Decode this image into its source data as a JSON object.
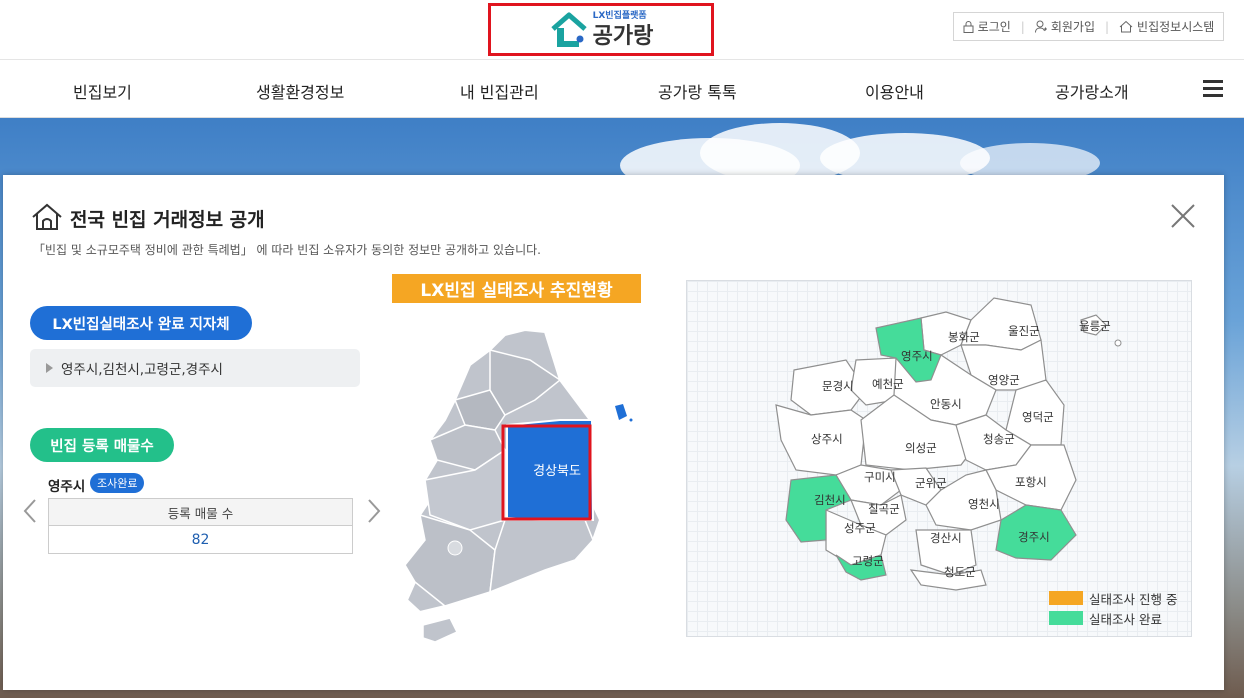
{
  "header": {
    "logo_sub": "LX빈집플랫폼",
    "logo_text": "공가랑",
    "util": {
      "login": "로그인",
      "join": "회원가입",
      "system": "빈집정보시스템"
    }
  },
  "nav": {
    "items": [
      "빈집보기",
      "생활환경정보",
      "내 빈집관리",
      "공가랑 톡톡",
      "이용안내",
      "공가랑소개"
    ]
  },
  "modal": {
    "title": "전국 빈집 거래정보 공개",
    "description": "「빈집 및 소규모주택 정비에 관한 특례법」 에 따라 빈집 소유자가 동의한 정보만 공개하고 있습니다.",
    "completed_section": {
      "label": "LX빈집실태조사 완료 지자체",
      "list": "영주시,김천시,고령군,경주시"
    },
    "count_section": {
      "label": "빈집 등록 매물수",
      "city": "영주시",
      "badge": "조사완료",
      "table_header": "등록 매물 수",
      "table_value": "82"
    },
    "banner": "LX빈집 실태조사 추진현황",
    "selected_region": "경상북도",
    "regions": {
      "uljin": "울진군",
      "ulleung": "울릉군",
      "bonghwa": "봉화군",
      "yeongju": "영주시",
      "yeongyang": "영양군",
      "mungyeong": "문경시",
      "yecheon": "예천군",
      "andong": "안동시",
      "yeongdeok": "영덕군",
      "sangju": "상주시",
      "uiseong": "의성군",
      "cheongsong": "청송군",
      "gumi": "구미시",
      "gunwi": "군위군",
      "pohang": "포항시",
      "gimcheon": "김천시",
      "chilgok": "칠곡군",
      "yeongcheon": "영천시",
      "seongju": "성주군",
      "gyeongju": "경주시",
      "gyeongsan": "경산시",
      "goryeong": "고령군",
      "cheongdo": "청도군"
    },
    "legend": {
      "in_progress": "실태조사 진행 중",
      "completed": "실태조사 완료"
    },
    "colors": {
      "primary": "#1f6fd6",
      "accent": "#23c08a",
      "orange": "#f5a623",
      "completed_region": "#45dc9a",
      "highlight": "#e0141e"
    }
  }
}
